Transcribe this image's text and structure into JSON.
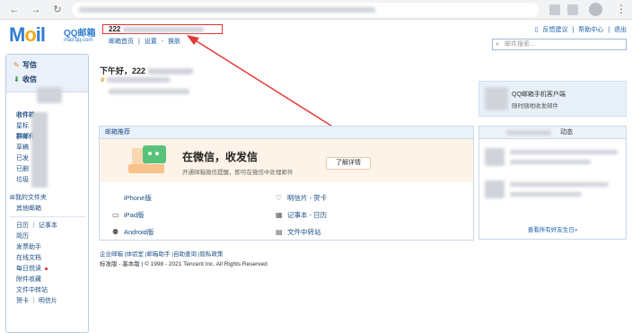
{
  "header": {
    "logo_main": "Mail",
    "logo_sub": "QQ邮箱",
    "logo_url": "mail.qq.com",
    "account_name": "222",
    "account_links": [
      "邮箱首页",
      "|",
      "设置",
      "-",
      "换肤"
    ],
    "top_links": [
      "反馈建议",
      "|",
      "帮助中心",
      "|",
      "退出"
    ],
    "search_placeholder": "邮件搜索..."
  },
  "sidebar": {
    "write_label": "写信",
    "inbox_label": "收信",
    "folders": [
      "收件箱",
      "星标",
      "群邮件",
      "草稿",
      "已发",
      "已删",
      "垃圾"
    ],
    "others": [
      "我的文件夹",
      "其他邮箱"
    ],
    "apps": [
      "日历 ｜ 记事本",
      "简历",
      "发票助手",
      "在线文档",
      "每日悦读",
      "附件收藏",
      "文件中转站",
      "贺卡 ｜ 明信片"
    ]
  },
  "main": {
    "greeting": "下午好，222",
    "recommend_title": "邮箱推荐",
    "banner_title": "在微信，收发信",
    "banner_sub": "开通邮箱微信提醒，即可在微信中处理邮件",
    "banner_button": "了解详情",
    "apps_left": [
      "iPhone版",
      "iPad版",
      "Android版"
    ],
    "apps_right": [
      "明信片 - 贺卡",
      "记事本 - 日历",
      "文件中转站"
    ],
    "footer_links": "企业邮箱 |体验室 |邮箱助手 |自助查询 |隐私政策",
    "footer_copy": "标准版 - 基本版 | © 1998 - 2021 Tencent Inc. All Rights Reserved"
  },
  "right": {
    "promo_title": "QQ邮箱手机客户端",
    "promo_sub": "随时随地收发邮件",
    "friends_tab": "动态",
    "friends_footer": "查看所有好友生日»"
  }
}
